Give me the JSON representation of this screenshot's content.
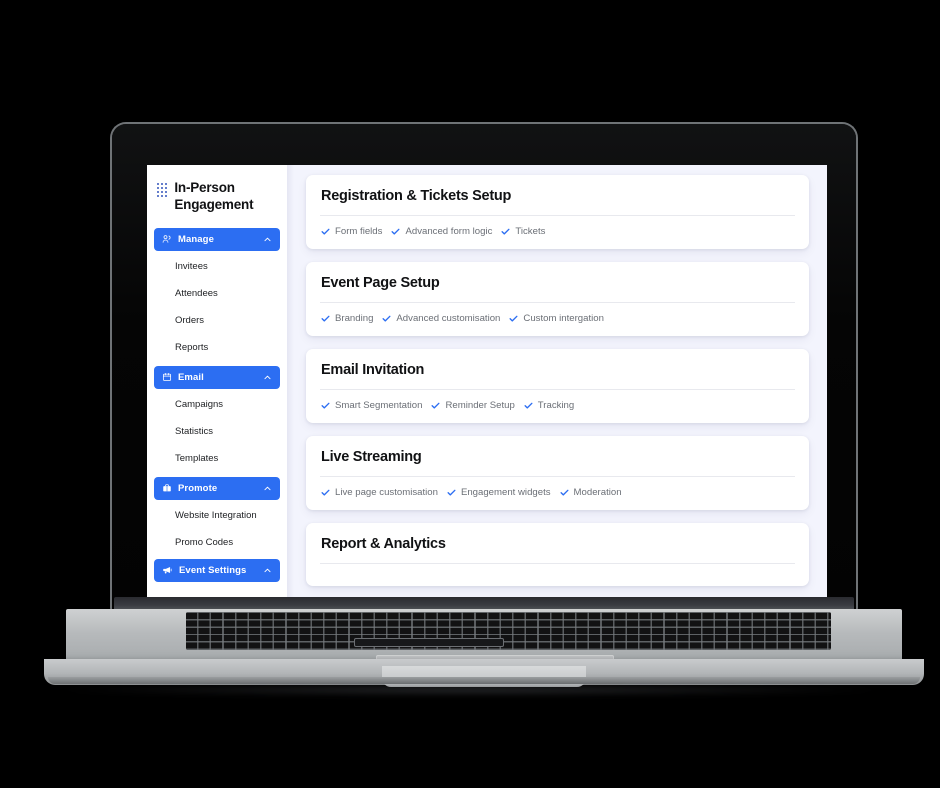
{
  "device": {
    "type": "laptop-mockup"
  },
  "app": {
    "brand": {
      "icon": "grid-dots-icon",
      "title": "In-Person\nEngagement"
    },
    "accent_color": "#2c6ef2",
    "page_background": "#f3f4fd",
    "sidebar": {
      "groups": [
        {
          "label": "Manage",
          "icon": "people-icon",
          "expanded": true,
          "chevron": "chevron-up-icon",
          "items": [
            "Invitees",
            "Attendees",
            "Orders",
            "Reports"
          ]
        },
        {
          "label": "Email",
          "icon": "calendar-icon",
          "expanded": true,
          "chevron": "chevron-up-icon",
          "items": [
            "Campaigns",
            "Statistics",
            "Templates"
          ]
        },
        {
          "label": "Promote",
          "icon": "briefcase-icon",
          "expanded": true,
          "chevron": "chevron-up-icon",
          "items": [
            "Website Integration",
            "Promo Codes"
          ]
        },
        {
          "label": "Event Settings",
          "icon": "megaphone-icon",
          "expanded": true,
          "chevron": "chevron-up-icon",
          "items": []
        }
      ]
    },
    "main": {
      "cards": [
        {
          "title": "Registration & Tickets Setup",
          "features": [
            "Form fields",
            "Advanced form logic",
            "Tickets"
          ]
        },
        {
          "title": "Event Page Setup",
          "features": [
            "Branding",
            "Advanced customisation",
            "Custom intergation"
          ]
        },
        {
          "title": "Email Invitation",
          "features": [
            "Smart Segmentation",
            "Reminder Setup",
            "Tracking"
          ]
        },
        {
          "title": "Live Streaming",
          "features": [
            "Live page customisation",
            "Engagement widgets",
            "Moderation"
          ]
        },
        {
          "title": "Report & Analytics",
          "features": []
        }
      ]
    }
  }
}
